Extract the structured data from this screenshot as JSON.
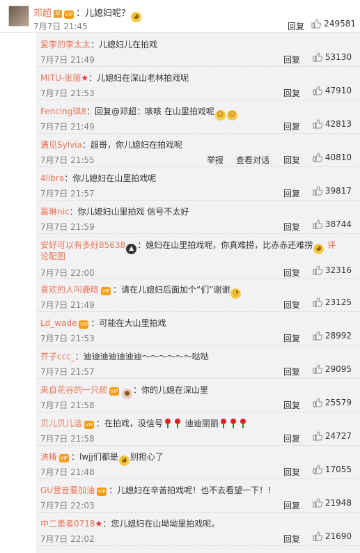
{
  "post": {
    "author": "邓超",
    "text": "：儿媳妇呢？",
    "time": "7月7日 21:45",
    "reply_label": "回复",
    "likes": "249581"
  },
  "comments": [
    {
      "author": "爱李的李太太",
      "text": "：儿媳妇儿在拍戏",
      "time": "7月7日 21:49",
      "reply": "回复",
      "likes": "53130"
    },
    {
      "author": "MITU-张丽",
      "text": "：儿媳妇在深山老林拍戏呢",
      "time": "7月7日 21:53",
      "reply": "回复",
      "likes": "47910"
    },
    {
      "author": "Fencing琪8",
      "text": "：回复@邓超：咳咳 在山里拍戏呢",
      "time": "7月7日 21:49",
      "reply": "回复",
      "likes": "42813"
    },
    {
      "author": "遇见Sylvia",
      "text": "：超哥，你儿媳妇在拍戏呢",
      "time": "7月7日 21:55",
      "reply": "回复",
      "likes": "40810",
      "report": "举报",
      "view_dialog": "查看对话"
    },
    {
      "author": "4libra",
      "text": "：你儿媳妇在山里拍戏呢",
      "time": "7月7日 21:57",
      "reply": "回复",
      "likes": "39817"
    },
    {
      "author": "嘉琳nic",
      "text": "：你儿媳妇山里拍戏 信号不太好",
      "time": "7月7日 21:59",
      "reply": "回复",
      "likes": "38744"
    },
    {
      "author": "安好可以有多好85638",
      "text": "：媳妇在山里拍戏呢，你真难捞，比赤赤还难捞",
      "line2": "论配图",
      "report_tag": "评",
      "time": "7月7日 22:00",
      "reply": "回复",
      "likes": "32316"
    },
    {
      "author": "喜欢的人叫鹿晗",
      "text": "：请在儿媳妇后面加个“们”谢谢",
      "time": "7月7日 21:49",
      "reply": "回复",
      "likes": "23125"
    },
    {
      "author": "Ld_wade",
      "text": "：可能在大山里拍戏",
      "time": "7月7日 21:53",
      "reply": "回复",
      "likes": "28992"
    },
    {
      "author": "芥子ccc_",
      "text": "：迪迪迪迪迪迪迪～～～～～～哒哒",
      "time": "7月7日 21:57",
      "reply": "回复",
      "likes": "29095"
    },
    {
      "author": "来自花谷的一只颜",
      "text": "：你的儿媳在深山里",
      "time": "7月7日 21:58",
      "reply": "回复",
      "likes": "25579"
    },
    {
      "author": "贝儿贝儿洁",
      "text": "：在拍戏，没信号",
      "text2": "迪迪丽丽",
      "time": "7月7日 21:58",
      "reply": "回复",
      "likes": "24727"
    },
    {
      "author": "泱椿",
      "text": "：lwjj们都是",
      "text2": "别担心了",
      "time": "7月7日 21:48",
      "reply": "回复",
      "likes": "17055"
    },
    {
      "author": "GU营音要加油",
      "text": "：儿媳妇在辛苦拍戏呢！也不去看望一下！！",
      "time": "7月7日 22:03",
      "reply": "回复",
      "likes": "21948"
    },
    {
      "author": "中二患者0718",
      "text": "：您儿媳妇在山坳坳里拍戏呢。",
      "time": "7月7日 22:02",
      "reply": "回复",
      "likes": "21690"
    }
  ],
  "colors": {
    "accent": "#eb7350",
    "comment_bg": "#f2f2f5"
  }
}
